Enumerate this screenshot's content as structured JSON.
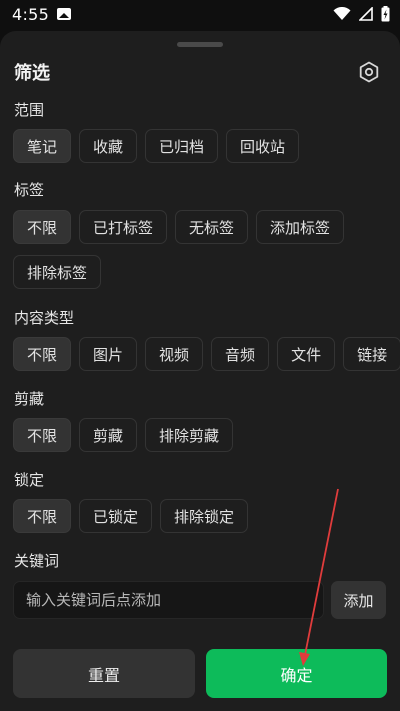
{
  "status_bar": {
    "time": "4:55"
  },
  "sheet": {
    "title": "筛选"
  },
  "sections": {
    "scope": {
      "label": "范围",
      "options": [
        "笔记",
        "收藏",
        "已归档",
        "回收站"
      ]
    },
    "tags": {
      "label": "标签",
      "options_row1": [
        "不限",
        "已打标签",
        "无标签",
        "添加标签"
      ],
      "options_row2": [
        "排除标签"
      ]
    },
    "content_type": {
      "label": "内容类型",
      "options": [
        "不限",
        "图片",
        "视频",
        "音频",
        "文件",
        "链接"
      ]
    },
    "clip": {
      "label": "剪藏",
      "options": [
        "不限",
        "剪藏",
        "排除剪藏"
      ]
    },
    "lock": {
      "label": "锁定",
      "options": [
        "不限",
        "已锁定",
        "排除锁定"
      ]
    },
    "keyword": {
      "label": "关键词",
      "placeholder": "输入关键词后点添加",
      "add_label": "添加"
    }
  },
  "footer": {
    "reset_label": "重置",
    "confirm_label": "确定"
  },
  "colors": {
    "accent": "#0dbb5a",
    "annotation": "#e03c3c",
    "sheet_bg": "#1e1e1e",
    "chip_selected": "#333333"
  }
}
